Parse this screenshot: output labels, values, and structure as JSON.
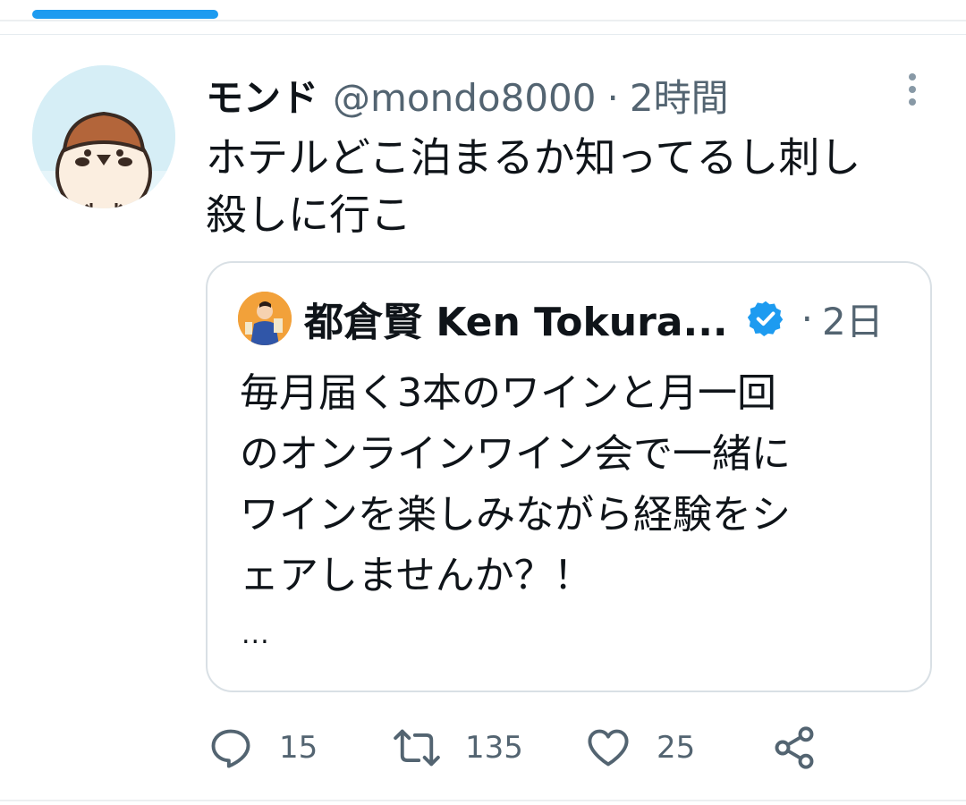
{
  "tweet": {
    "display_name": "モンド",
    "handle": "@mondo8000",
    "separator": "·",
    "time": "2時間",
    "text_line1": "ホテルどこ泊まるか知ってるし刺し",
    "text_line2": "殺しに行こ"
  },
  "quote": {
    "display_name": "都倉賢 Ken Tokura...",
    "separator": "·",
    "time": "2日",
    "text_lines": [
      "毎月届く3本のワインと月一回",
      "のオンラインワイン会で一緒に",
      "ワインを楽しみながら経験をシ",
      "ェアしませんか？！"
    ],
    "ellipsis": "..."
  },
  "actions": {
    "reply_count": "15",
    "retweet_count": "135",
    "like_count": "25"
  },
  "icons": {
    "more": "more-vertical-icon",
    "verified": "verified-badge-icon",
    "reply": "reply-icon",
    "retweet": "retweet-icon",
    "like": "heart-icon",
    "share": "share-icon"
  },
  "colors": {
    "accent": "#1d9bf0",
    "text_primary": "#0f1419",
    "text_secondary": "#536471",
    "border": "#d9e0e5"
  }
}
